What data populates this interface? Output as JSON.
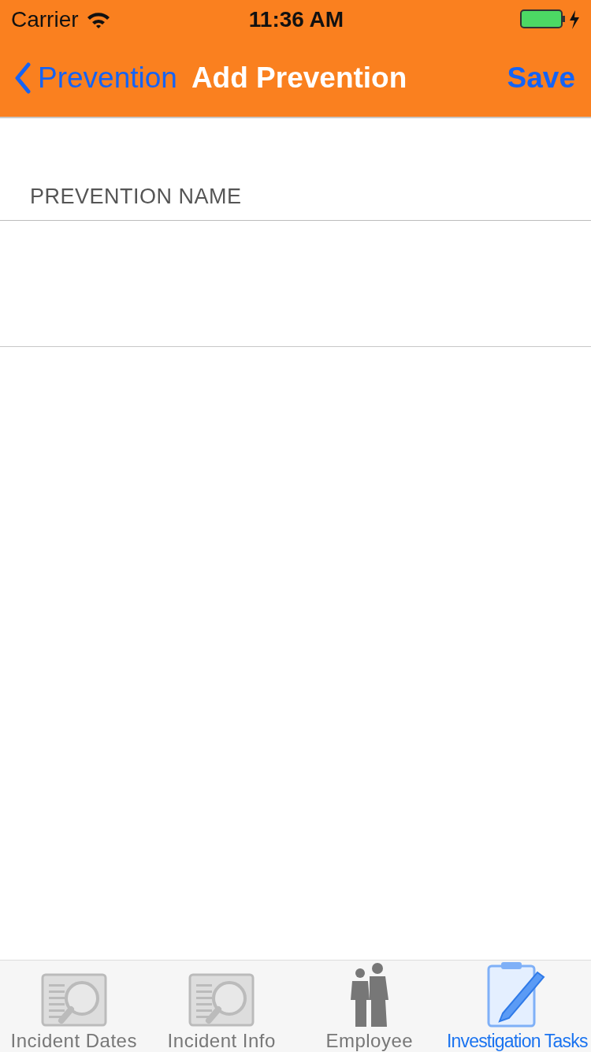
{
  "status_bar": {
    "carrier": "Carrier",
    "time": "11:36 AM"
  },
  "nav_bar": {
    "back": "Prevention",
    "title": "Add Prevention",
    "action": "Save"
  },
  "form": {
    "section_header": "PREVENTION NAME"
  },
  "tab_bar": [
    {
      "label": "Incident Dates",
      "kind": "document",
      "selected": false
    },
    {
      "label": "Incident Info",
      "kind": "document",
      "selected": false
    },
    {
      "label": "Employee",
      "kind": "people",
      "selected": false
    },
    {
      "label": "Investigation Tasks",
      "kind": "clipboard",
      "selected": true
    }
  ]
}
